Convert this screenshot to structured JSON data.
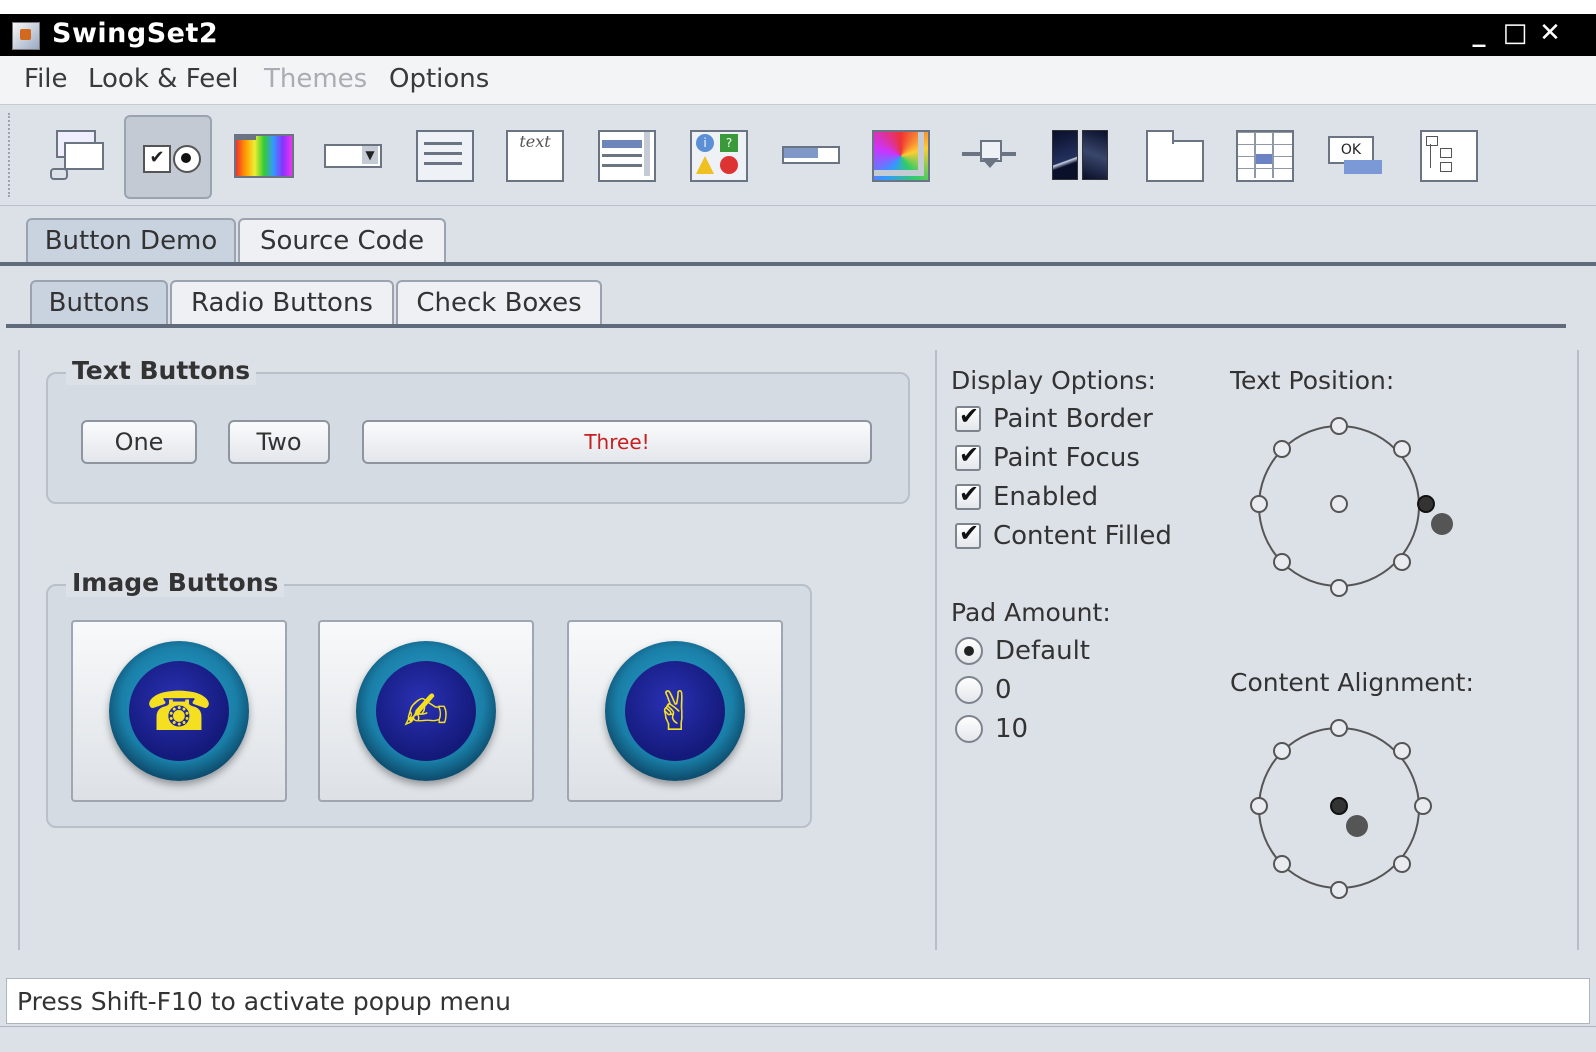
{
  "window": {
    "title": "SwingSet2",
    "minimize": "_",
    "maximize": "□",
    "close": "✕"
  },
  "menubar": {
    "items": [
      {
        "label": "File",
        "enabled": true
      },
      {
        "label": "Look & Feel",
        "enabled": true
      },
      {
        "label": "Themes",
        "enabled": false
      },
      {
        "label": "Options",
        "enabled": true
      }
    ]
  },
  "toolbar": {
    "tools": [
      "internal-frame-demo-icon",
      "button-demo-icon",
      "color-chooser-demo-icon",
      "combobox-demo-icon",
      "file-chooser-demo-icon",
      "html-demo-icon",
      "list-demo-icon",
      "option-pane-demo-icon",
      "progress-bar-demo-icon",
      "scroll-pane-demo-icon",
      "slider-demo-icon",
      "split-pane-demo-icon",
      "tabbed-pane-demo-icon",
      "table-demo-icon",
      "tooltip-demo-icon",
      "tree-demo-icon"
    ],
    "selected": "button-demo-icon",
    "html_demo_text": "text"
  },
  "outer_tabs": {
    "demo": "Button Demo",
    "source": "Source Code",
    "active": "demo"
  },
  "inner_tabs": {
    "buttons": "Buttons",
    "radio": "Radio Buttons",
    "check": "Check Boxes",
    "active": "buttons"
  },
  "text_buttons": {
    "legend": "Text Buttons",
    "one": "One",
    "two": "Two",
    "three": "Three!",
    "three_color": "#c62020"
  },
  "image_buttons": {
    "legend": "Image Buttons",
    "icons": [
      "telephone-icon",
      "write-pen-icon",
      "peace-hand-icon"
    ],
    "glyphs": [
      "☎",
      "✍",
      "✌"
    ]
  },
  "display_options": {
    "label": "Display Options:",
    "items": [
      {
        "label": "Paint Border",
        "checked": true
      },
      {
        "label": "Paint Focus",
        "checked": true
      },
      {
        "label": "Enabled",
        "checked": true
      },
      {
        "label": "Content Filled",
        "checked": true
      }
    ]
  },
  "pad_amount": {
    "label": "Pad Amount:",
    "options": [
      {
        "label": "Default",
        "selected": true
      },
      {
        "label": "0",
        "selected": false
      },
      {
        "label": "10",
        "selected": false
      }
    ]
  },
  "text_position": {
    "label": "Text Position:",
    "selected": "east"
  },
  "content_alignment": {
    "label": "Content Alignment:",
    "selected": "center"
  },
  "status": {
    "text": "Press Shift-F10 to activate popup menu"
  },
  "colors": {
    "accent": "#c9d3e0",
    "panel": "#dce1e8",
    "titlebar": "#000000"
  }
}
